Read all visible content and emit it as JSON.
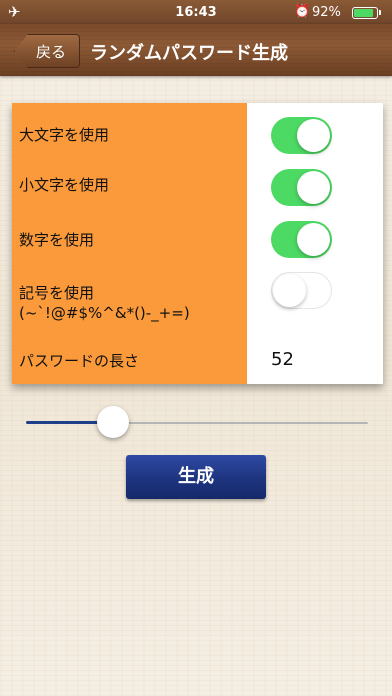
{
  "status_bar": {
    "airplane_icon": "✈",
    "time": "16:43",
    "alarm_icon": "⏰",
    "battery_percent_text": "92%",
    "battery_level": 0.92,
    "battery_color": "#4cd964"
  },
  "nav": {
    "back_label": "戻る",
    "title": "ランダムパスワード生成"
  },
  "settings": {
    "uppercase_label": "大文字を使用",
    "uppercase_on": true,
    "lowercase_label": "小文字を使用",
    "lowercase_on": true,
    "digits_label": "数字を使用",
    "digits_on": true,
    "symbols_label": "記号を使用",
    "symbols_chars": "(~`!@#$%^&*()-_+=)",
    "symbols_on": false,
    "length_label": "パスワードの長さ",
    "length_value": "52"
  },
  "slider": {
    "fraction": 0.23
  },
  "generate_button": {
    "label": "生成"
  },
  "colors": {
    "panel_left": "#fb9a3b",
    "toggle_on": "#4cd964",
    "button_blue": "#1d347f",
    "slider_fill": "#1e3f8a",
    "nav_brown": "#7a4a2b"
  }
}
